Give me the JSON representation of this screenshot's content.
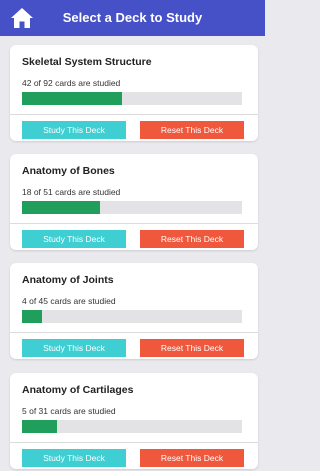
{
  "header": {
    "title": "Select a Deck to Study",
    "home_icon": "home-icon"
  },
  "colors": {
    "header": "#4651c8",
    "progress": "#1f9e5c",
    "study": "#3fcfd2",
    "reset": "#f0583e"
  },
  "decks": [
    {
      "title": "Skeletal System Structure",
      "status": "42 of 92 cards are studied",
      "progress": 0.456,
      "study_label": "Study This Deck",
      "reset_label": "Reset This Deck"
    },
    {
      "title": "Anatomy of Bones",
      "status": "18 of 51 cards are studied",
      "progress": 0.353,
      "study_label": "Study This Deck",
      "reset_label": "Reset This Deck"
    },
    {
      "title": "Anatomy of Joints",
      "status": "4 of 45 cards are studied",
      "progress": 0.089,
      "study_label": "Study This Deck",
      "reset_label": "Reset This Deck"
    },
    {
      "title": "Anatomy of Cartilages",
      "status": "5 of 31 cards are studied",
      "progress": 0.161,
      "study_label": "Study This Deck",
      "reset_label": "Reset This Deck"
    }
  ]
}
